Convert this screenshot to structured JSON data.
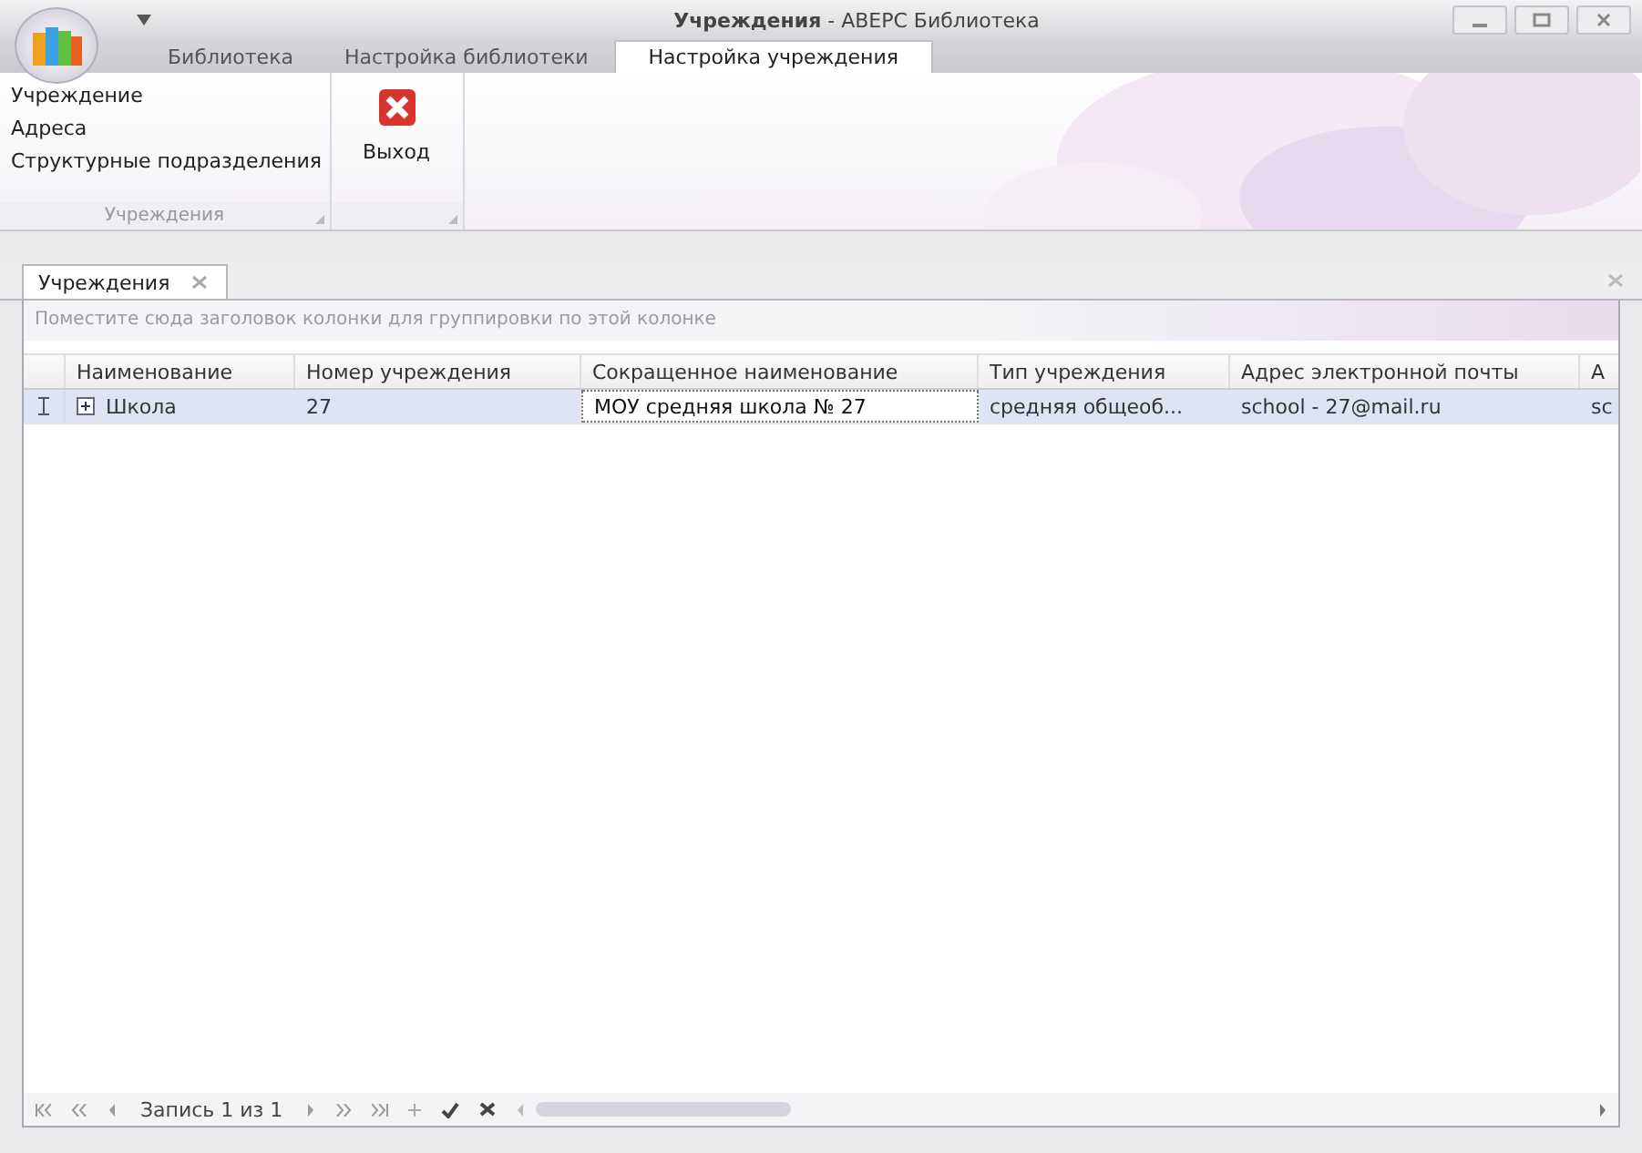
{
  "window": {
    "title_bold": "Учреждения",
    "title_rest": " - АВЕРС Библиотека"
  },
  "ribbon_tabs": [
    {
      "label": "Библиотека",
      "selected": false
    },
    {
      "label": "Настройка библиотеки",
      "selected": false
    },
    {
      "label": "Настройка учреждения",
      "selected": true
    }
  ],
  "ribbon_groups": [
    {
      "kind": "list",
      "caption": "Учреждения",
      "items": [
        "Учреждение",
        "Адреса",
        "Структурные подразделения"
      ]
    },
    {
      "kind": "button",
      "items": [
        "Выход"
      ]
    }
  ],
  "document_tabs": [
    {
      "label": "Учреждения",
      "selected": true
    }
  ],
  "grid": {
    "group_hint": "Поместите сюда заголовок колонки для группировки по этой колонке",
    "columns": [
      "Наименование",
      "Номер учреждения",
      "Сокращенное наименование",
      "Тип учреждения",
      "Адрес электронной почты",
      "А"
    ],
    "rows": [
      {
        "selected": true,
        "editing": true,
        "expandable": true,
        "cells": [
          {
            "text": "Школа",
            "focused": false
          },
          {
            "text": "27",
            "focused": false
          },
          {
            "text": "МОУ средняя школа  № 27",
            "focused": true
          },
          {
            "text": "средняя общеоб...",
            "focused": false
          },
          {
            "text": "school - 27@mail.ru",
            "focused": false
          },
          {
            "text": "sc",
            "focused": false
          }
        ]
      }
    ]
  },
  "navigator": {
    "record_text": "Запись 1 из 1"
  }
}
